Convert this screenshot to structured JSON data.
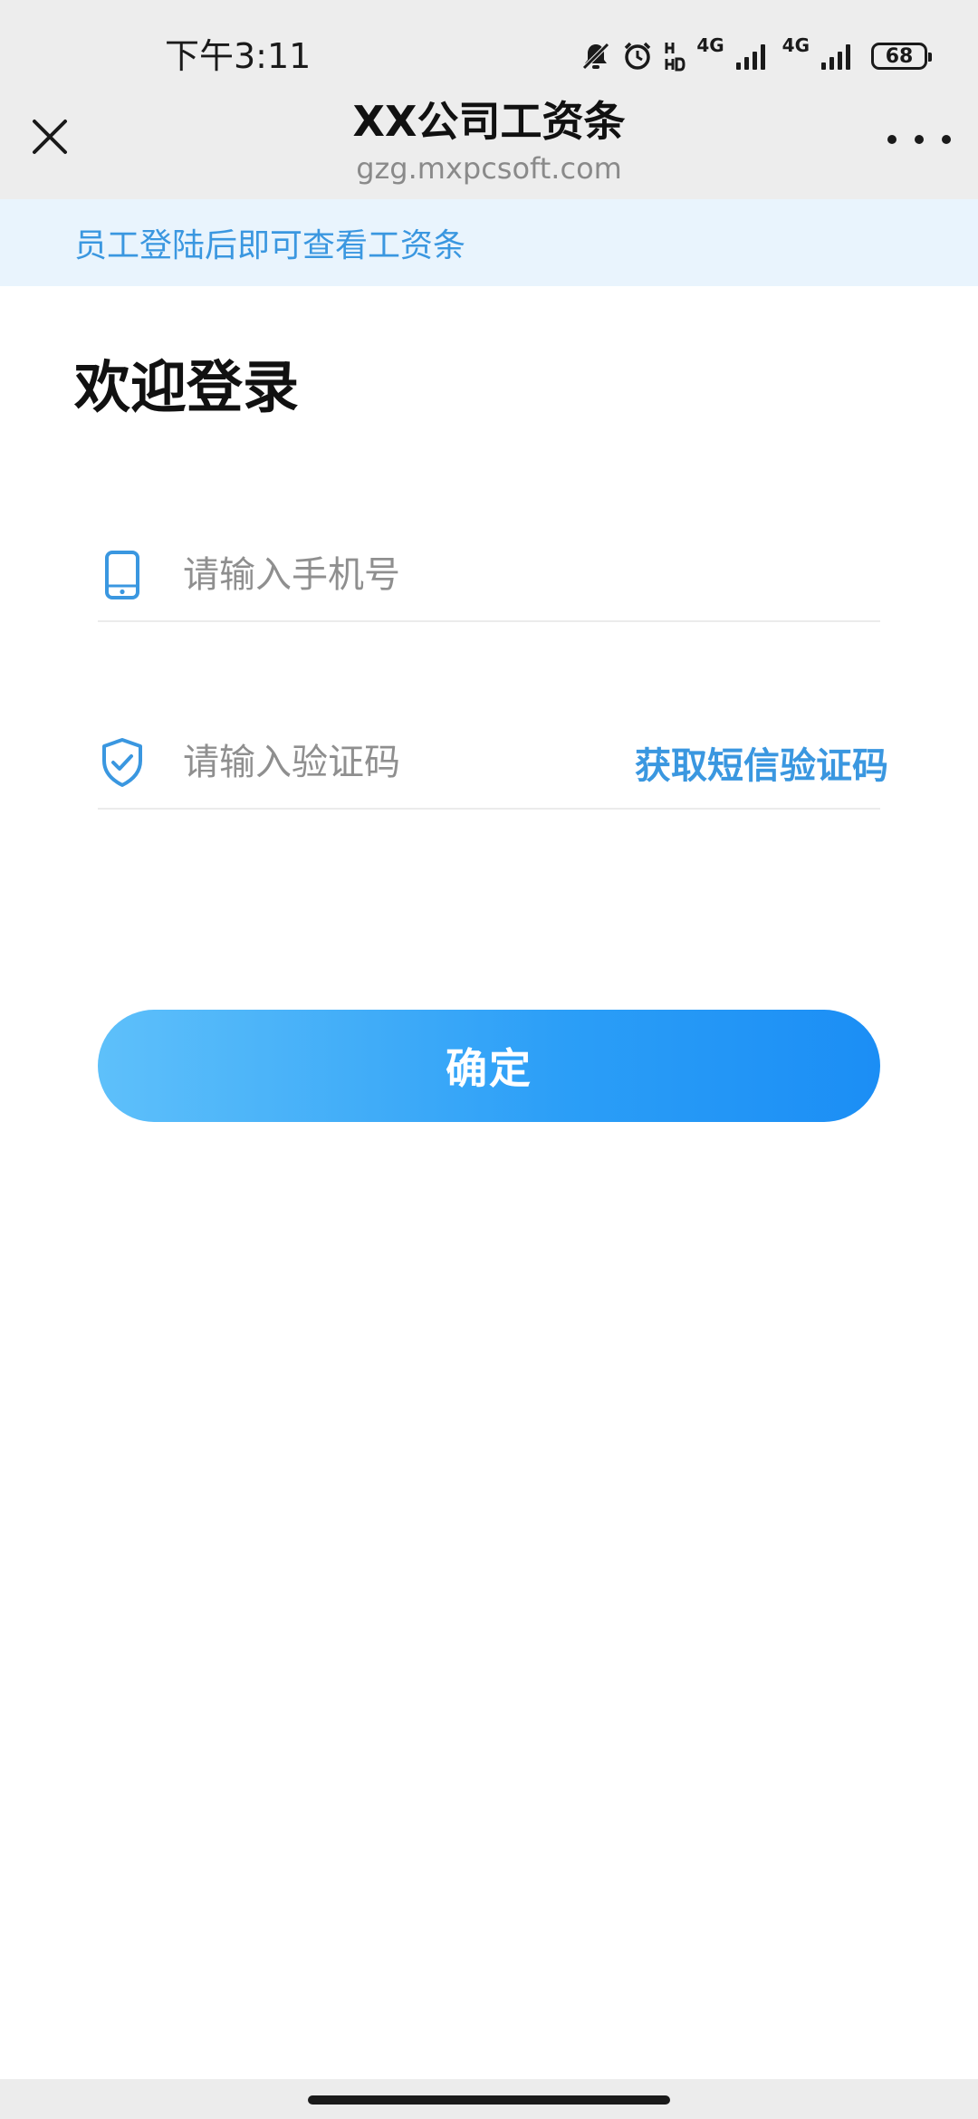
{
  "status_bar": {
    "time": "下午3:11",
    "network_1": "4G",
    "network_2": "4G",
    "battery": "68",
    "icons": [
      "bell-muted-icon",
      "alarm-icon",
      "hd-icon",
      "signal-icon",
      "signal-icon"
    ]
  },
  "nav": {
    "title": "XX公司工资条",
    "url": "gzg.mxpcsoft.com",
    "close_icon": "close-icon",
    "more_icon": "more-icon"
  },
  "notice": {
    "text": "员工登陆后即可查看工资条"
  },
  "login": {
    "heading": "欢迎登录",
    "phone": {
      "placeholder": "请输入手机号",
      "value": "",
      "icon": "phone-icon"
    },
    "code": {
      "placeholder": "请输入验证码",
      "value": "",
      "icon": "shield-check-icon",
      "sms_button": "获取短信验证码"
    },
    "confirm_label": "确定"
  },
  "colors": {
    "accent": "#3a97e0",
    "notice_bg": "#e9f4fd",
    "button_start": "#5ec0fa",
    "button_end": "#1b8ef5",
    "top_bg": "#ededed"
  }
}
